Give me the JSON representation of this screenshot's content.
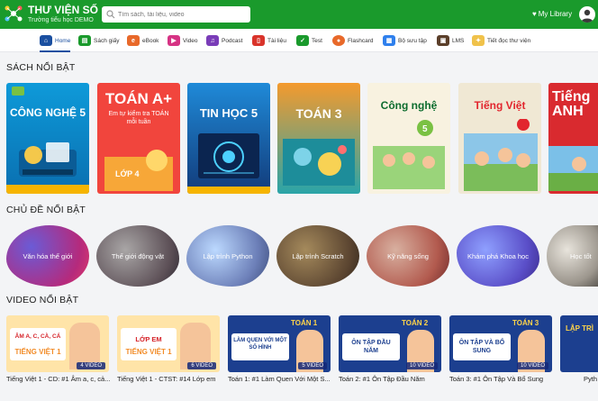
{
  "header": {
    "title": "THƯ VIỆN SỐ",
    "subtitle": "Trường tiểu học DEMO",
    "search_placeholder": "Tìm sách, tài liệu, video",
    "my_library": "My Library",
    "brand_color": "#1a9a2c"
  },
  "nav": [
    {
      "label": "Home",
      "icon": "home-icon"
    },
    {
      "label": "Sách giấy",
      "icon": "book-icon"
    },
    {
      "label": "eBook",
      "icon": "ebook-icon"
    },
    {
      "label": "Video",
      "icon": "video-icon"
    },
    {
      "label": "Podcast",
      "icon": "headphones-icon"
    },
    {
      "label": "Tài liệu",
      "icon": "document-icon"
    },
    {
      "label": "Test",
      "icon": "test-icon"
    },
    {
      "label": "Flashcard",
      "icon": "flashcard-icon"
    },
    {
      "label": "Bộ sưu tập",
      "icon": "collection-icon"
    },
    {
      "label": "LMS",
      "icon": "lms-icon"
    },
    {
      "label": "Tiết đọc thư viện",
      "icon": "reading-icon"
    }
  ],
  "sections": {
    "books": "SÁCH NỔI BẬT",
    "topics": "CHỦ ĐỀ NỔI BẬT",
    "videos": "VIDEO NỔI BẬT"
  },
  "books": [
    {
      "title": "CÔNG NGHỆ 5",
      "color": "#0d8fd4"
    },
    {
      "title": "TOÁN A+",
      "sub": "Em tự kiểm tra TOÁN mỗi tuần",
      "color": "#e4453f"
    },
    {
      "title": "TIN HỌC 5",
      "color": "#1d6fc0"
    },
    {
      "title": "TOÁN 3",
      "color": "#e67a22"
    },
    {
      "title": "Công nghệ",
      "color": "#43a54a"
    },
    {
      "title": "Tiếng Việt",
      "color": "#d94c3a"
    },
    {
      "title": "Tiếng ANH",
      "color": "#c6242e"
    }
  ],
  "topics": [
    "Văn hóa thế giới",
    "Thế giới động vật",
    "Lập trình Python",
    "Lập trình Scratch",
    "Kỹ năng sống",
    "Khám phá Khoa học",
    "Học tốt"
  ],
  "videos": [
    {
      "caption": "Tiếng Việt 1 - CD: #1 Âm a, c, cả...",
      "badge": "4 VIDEO",
      "headline": "ÂM A, C, CÀ, CÁ",
      "label": "TIẾNG VIỆT 1"
    },
    {
      "caption": "Tiếng Việt 1 - CTST: #14 Lớp em",
      "badge": "6 VIDEO",
      "headline": "LỚP EM",
      "label": "TIẾNG VIỆT 1"
    },
    {
      "caption": "Toán 1: #1 Làm Quen Với Một S...",
      "badge": "5 VIDEO",
      "headline": "LÀM QUEN VỚI MỘT SỐ HÌNH",
      "label": "TOÁN 1"
    },
    {
      "caption": "Toán 2: #1 Ôn Tập Đầu Năm",
      "badge": "10 VIDEO",
      "headline": "ÔN TẬP ĐẦU NĂM",
      "label": "TOÁN 2"
    },
    {
      "caption": "Toán 3: #1 Ôn Tập Và Bổ Sung",
      "badge": "10 VIDEO",
      "headline": "ÔN TẬP VÀ BỔ SUNG",
      "label": "TOÁN 3"
    },
    {
      "caption": "Pyth",
      "badge": "",
      "headline": "LẬP TRÌ",
      "label": ""
    }
  ]
}
